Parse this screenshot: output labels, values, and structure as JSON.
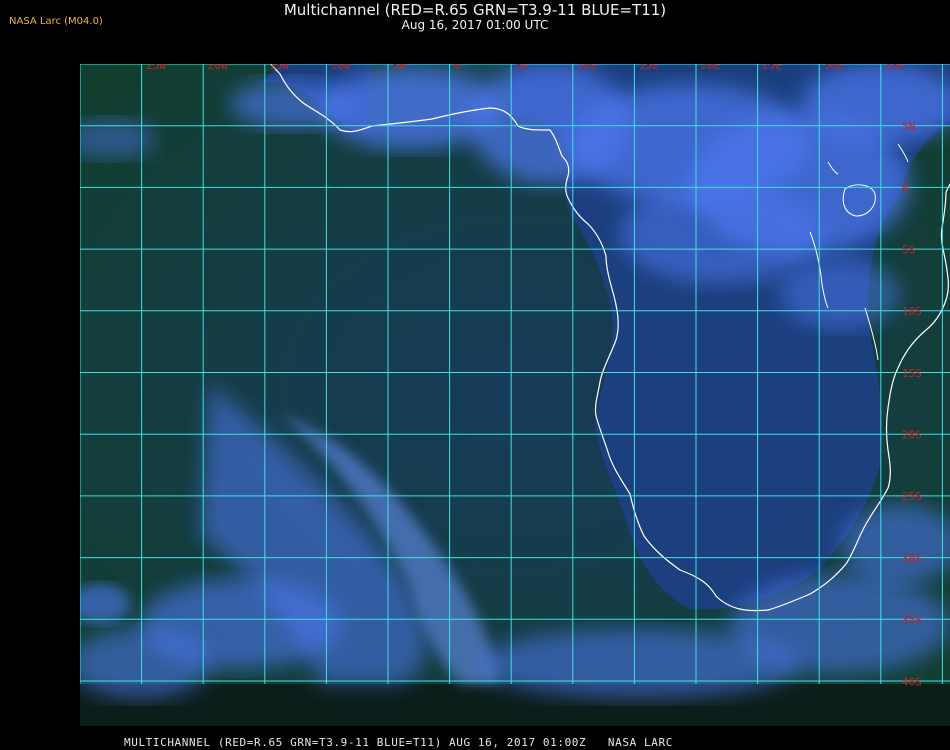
{
  "header": {
    "title": "Multichannel (RED=R.65 GRN=T3.9-11 BLUE=T11)",
    "datetime": "Aug 16, 2017 01:00 UTC",
    "credit": "NASA Larc (M04.0)"
  },
  "footer": {
    "caption": "MULTICHANNEL (RED=R.65 GRN=T3.9-11 BLUE=T11) AUG 16, 2017 01:00Z   NASA LARC"
  },
  "map": {
    "longitude_labels": [
      "25W",
      "20W",
      "15W",
      "10W",
      "5W",
      "0",
      "5E",
      "10E",
      "15E",
      "20E",
      "25E",
      "30E",
      "35E"
    ],
    "latitude_labels": [
      "5N",
      "0",
      "5S",
      "10S",
      "15S",
      "20S",
      "25S",
      "30S",
      "35S",
      "40S"
    ],
    "colors": {
      "grid": "#40e0e0",
      "coastline": "#ffffff",
      "label": "#cc2020",
      "land": "#1e3e80",
      "ocean_dark": "#0e3a2a",
      "cloud": "#5a86ff"
    }
  }
}
